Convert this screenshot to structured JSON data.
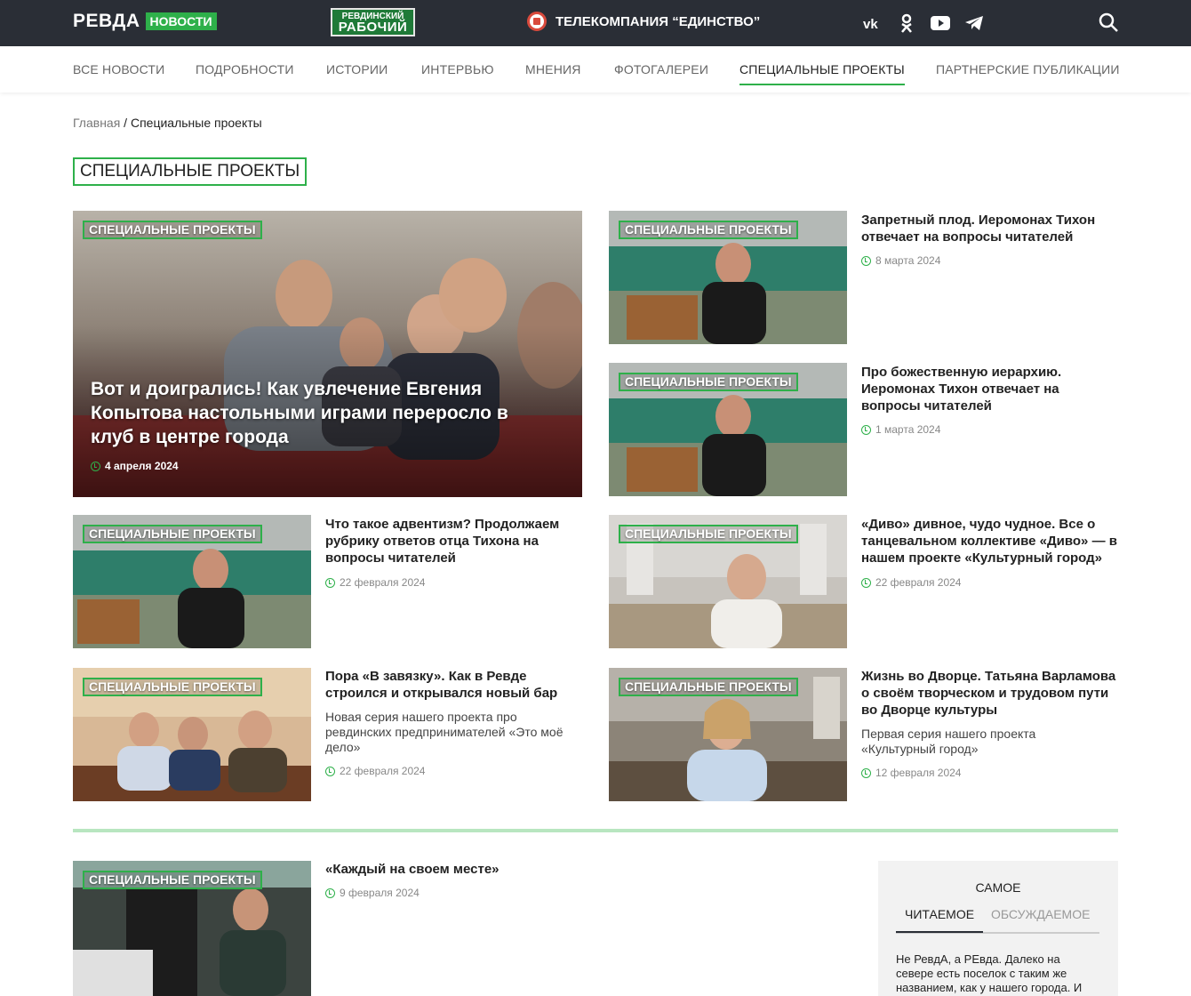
{
  "header": {
    "logo_main": "РЕВДА",
    "logo_badge": "НОВОСТИ",
    "partner_logo_line1": "РЕВДИНСКИЙ",
    "partner_logo_line2": "РАБОЧИЙ",
    "tv_label": "ТЕЛЕКОМПАНИЯ “ЕДИНСТВО”",
    "socials": [
      "vk-icon",
      "odnoklassniki-icon",
      "youtube-icon",
      "telegram-icon"
    ]
  },
  "nav": {
    "items": [
      "ВСЕ НОВОСТИ",
      "ПОДРОБНОСТИ",
      "ИСТОРИИ",
      "ИНТЕРВЬЮ",
      "МНЕНИЯ",
      "ФОТОГАЛЕРЕИ",
      "СПЕЦИАЛЬНЫЕ ПРОЕКТЫ",
      "ПАРТНЕРСКИЕ ПУБЛИКАЦИИ"
    ],
    "active_index": 6
  },
  "breadcrumb": {
    "home": "Главная",
    "separator": " / ",
    "current": "Специальные проекты"
  },
  "section_title": "СПЕЦИАЛЬНЫЕ ПРОЕКТЫ",
  "tag_label": "СПЕЦИАЛЬНЫЕ ПРОЕКТЫ",
  "hero": {
    "title": "Вот и доигрались! Как увлечение Евгения Копытова настольными играми переросло в клуб в центре города",
    "date": "4 апреля 2024"
  },
  "articles": [
    {
      "title": "Запретный плод. Иеромонах Тихон отвечает на вопросы читателей",
      "lead": "",
      "date": "8 марта 2024"
    },
    {
      "title": "Про божественную иерархию. Иеромонах Тихон отвечает на вопросы читателей",
      "lead": "",
      "date": "1 марта 2024"
    },
    {
      "title": "Что такое адвентизм? Продолжаем рубрику ответов отца Тихона на вопросы читателей",
      "lead": "",
      "date": "22 февраля 2024"
    },
    {
      "title": "«Диво» дивное, чудо чудное. Все о танцевальном коллективе «Диво» — в нашем проекте «Культурный город»",
      "lead": "",
      "date": "22 февраля 2024"
    },
    {
      "title": "Пора «В завязку». Как в Ревде строился и открывался новый бар",
      "lead": "Новая серия нашего проекта про ревдинских предпринимателей «Это моё дело»",
      "date": "22 февраля 2024"
    },
    {
      "title": "Жизнь во Дворце. Татьяна Варламова о своём творческом и трудовом пути во Дворце культуры",
      "lead": "Первая серия нашего проекта «Культурный город»",
      "date": "12 февраля 2024"
    },
    {
      "title": "«Каждый на своем месте»",
      "lead": "",
      "date": "9 февраля 2024"
    }
  ],
  "aside": {
    "heading": "САМОЕ",
    "tabs": [
      "ЧИТАЕМОЕ",
      "ОБСУЖДАЕМОЕ"
    ],
    "active_tab": 0,
    "first_item": "Не РевдА, а РЕвда. Далеко на севере есть поселок с таким же названием, как у нашего города. И"
  },
  "colors": {
    "accent": "#2eb04a",
    "topbar": "#2a2e36",
    "divider": "#b8e6c0"
  }
}
